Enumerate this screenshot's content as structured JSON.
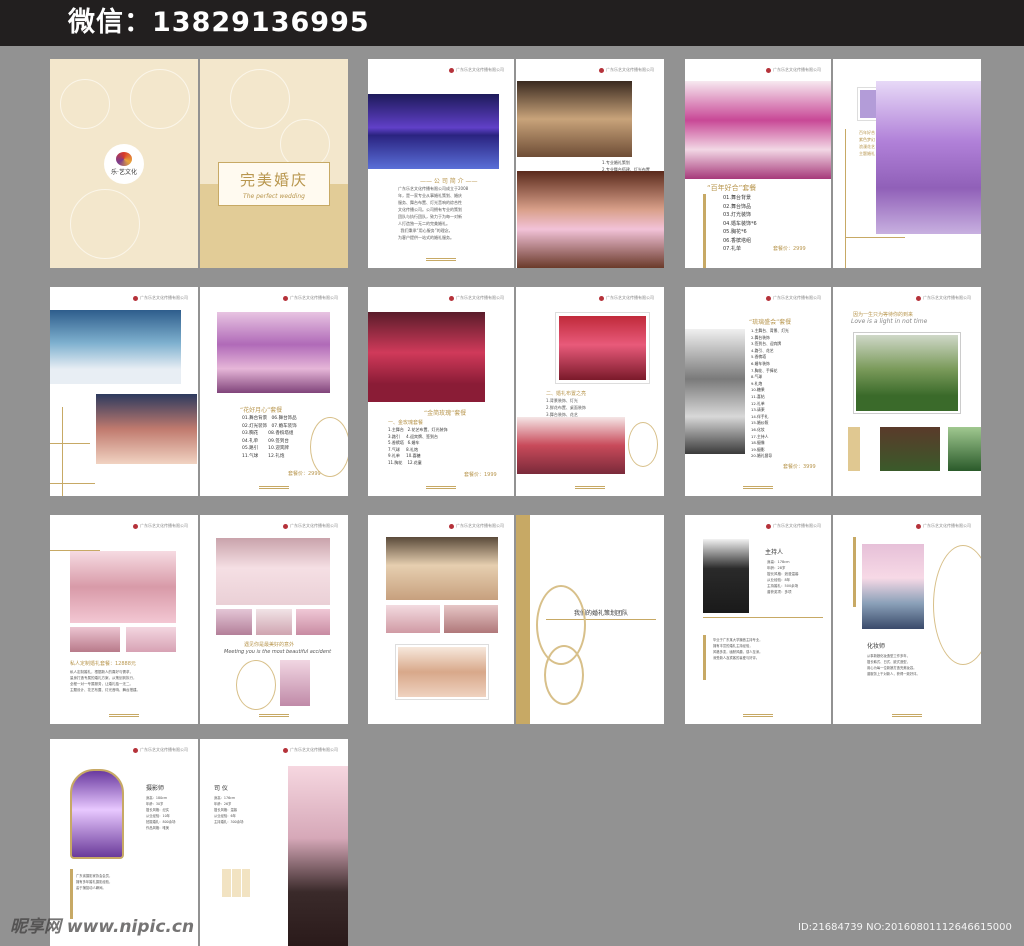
{
  "header": {
    "contact": "微信：13829136995"
  },
  "cover": {
    "logo_text": "乐·艺文化",
    "title": "完美婚庆",
    "subtitle": "The perfect wedding"
  },
  "packages": [
    {
      "name": "“百年好合”套餐",
      "items": [
        "01.舞台背景",
        "02.舞台饰品",
        "03.灯光装饰",
        "04.婚车装饰*6",
        "05.胸花*6",
        "06.香槟塔组",
        "07.礼单"
      ],
      "price": "套餐价：2999"
    },
    {
      "name": "“花好月心”套餐",
      "price": "套餐价：2999"
    },
    {
      "name": "“金简玫瑰”套餐",
      "price": "套餐价：1999"
    },
    {
      "name": "“琉璃盛会”套餐",
      "price": "套餐价：3999"
    }
  ],
  "sections": {
    "team": "我们的婚礼策划团队",
    "private": "私人定制婚礼套餐：12888元",
    "slogan_cn": "遇见你是最美好的意外",
    "slogan_en": "Meeting you is the most beautiful accident",
    "love_cn": "因为一生只为等待你的到来",
    "love_en": "Love is a light in not time",
    "host1": "主持人",
    "host2": "化妆师",
    "host3": "摄影师",
    "host4": "司 仪"
  },
  "watermark": {
    "site": "昵享网 www.nipic.cn",
    "id": "ID:21684739 NO:20160801112646615000"
  }
}
